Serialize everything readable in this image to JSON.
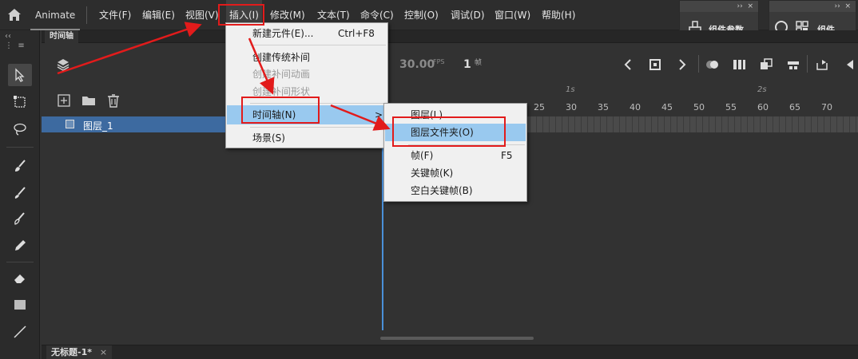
{
  "app": {
    "name": "Animate"
  },
  "menubar": {
    "items": [
      "文件(F)",
      "编辑(E)",
      "视图(V)",
      "插入(I)",
      "修改(M)",
      "文本(T)",
      "命令(C)",
      "控制(O)",
      "调试(D)",
      "窗口(W)",
      "帮助(H)"
    ]
  },
  "panels": {
    "component_params": "组件参数",
    "components": "组件",
    "collapse_glyph": "››",
    "close_glyph": "×"
  },
  "timeline": {
    "tab": "时间轴",
    "fps_value": "30.00",
    "fps_unit": "FPS",
    "frame_value": "1",
    "frame_unit": "帧",
    "layer_name": "图层_1",
    "second_labels": [
      "1s",
      "2s"
    ],
    "frame_ticks": [
      "25",
      "30",
      "35",
      "40",
      "45",
      "50",
      "55",
      "60",
      "65",
      "70"
    ]
  },
  "document": {
    "tab": "无标题-1*",
    "close_glyph": "×"
  },
  "insert_menu": {
    "items": [
      {
        "label": "新建元件(E)...",
        "shortcut": "Ctrl+F8",
        "disabled": false
      },
      {
        "label": "创建传统补间",
        "shortcut": "",
        "disabled": false
      },
      {
        "label": "创建补间动画",
        "shortcut": "",
        "disabled": true
      },
      {
        "label": "创建补间形状",
        "shortcut": "",
        "disabled": true
      },
      {
        "label": "时间轴(N)",
        "shortcut": "",
        "disabled": false,
        "submenu_glyph": ">"
      },
      {
        "label": "场景(S)",
        "shortcut": "",
        "disabled": false
      }
    ]
  },
  "timeline_submenu": {
    "items": [
      {
        "label": "图层(L)",
        "shortcut": ""
      },
      {
        "label": "图层文件夹(O)",
        "shortcut": ""
      },
      {
        "label": "帧(F)",
        "shortcut": "F5"
      },
      {
        "label": "关键帧(K)",
        "shortcut": ""
      },
      {
        "label": "空白关键帧(B)",
        "shortcut": ""
      }
    ]
  },
  "colors": {
    "annotation": "#e21b1b",
    "menu_highlight": "#99c9ef",
    "layer_selected": "#3d6aa0",
    "playhead": "#4a90d9"
  },
  "icons": [
    "home-icon",
    "layers-icon",
    "add-layer-icon",
    "folder-icon",
    "trash-icon",
    "arrow-tool-icon",
    "free-transform-icon",
    "lasso-icon",
    "brush-icon",
    "paint-brush-icon",
    "pencil-icon",
    "eraser-icon",
    "rectangle-icon",
    "line-icon",
    "play-icon",
    "stop-icon"
  ]
}
